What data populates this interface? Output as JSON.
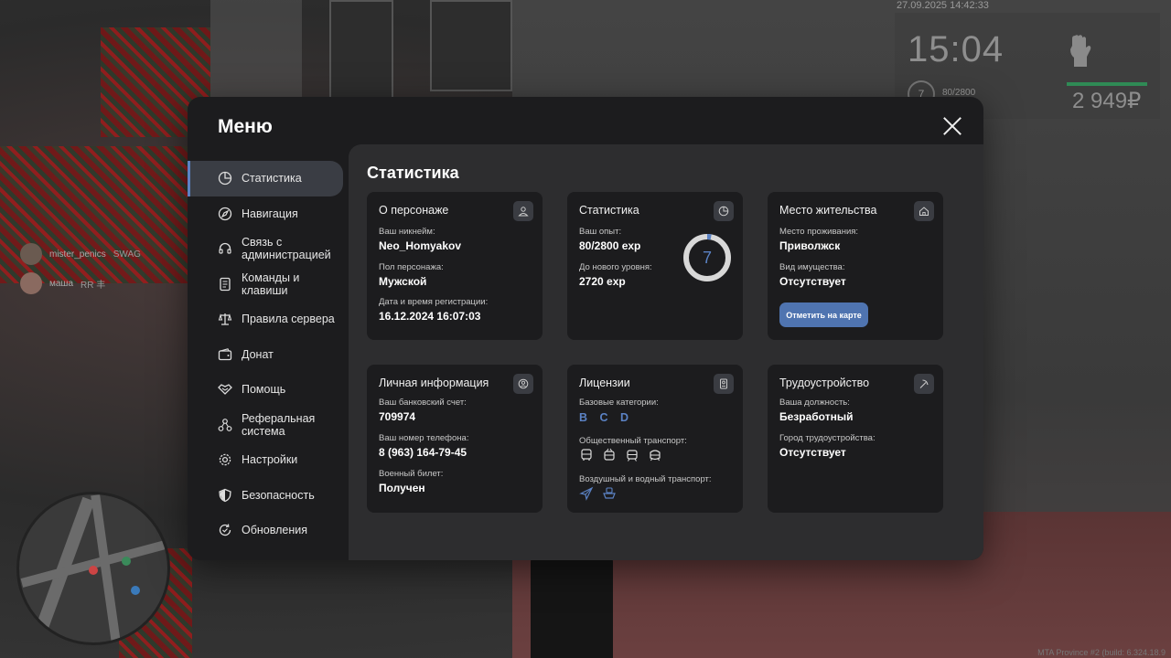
{
  "hud": {
    "datetime": "27.09.2025 14:42:33",
    "time": "15:04",
    "level": "7",
    "exp": "80/2800",
    "money": "2 949₽"
  },
  "chat": [
    {
      "name": "mister_penics",
      "tag": "SWAG"
    },
    {
      "name": "маша",
      "tag": "RR 丰"
    }
  ],
  "footer": "MTA Province #2 (build: 6.324.18.9",
  "menu": {
    "title": "Меню",
    "nav": [
      {
        "label": "Статистика",
        "icon": "stats-pie-icon"
      },
      {
        "label": "Навигация",
        "icon": "compass-icon"
      },
      {
        "label": "Связь с администрацией",
        "icon": "headset-icon"
      },
      {
        "label": "Команды и клавиши",
        "icon": "document-icon"
      },
      {
        "label": "Правила сервера",
        "icon": "scales-icon"
      },
      {
        "label": "Донат",
        "icon": "wallet-icon"
      },
      {
        "label": "Помощь",
        "icon": "handshake-icon"
      },
      {
        "label": "Реферальная система",
        "icon": "network-icon"
      },
      {
        "label": "Настройки",
        "icon": "gear-icon"
      },
      {
        "label": "Безопасность",
        "icon": "shield-icon"
      },
      {
        "label": "Обновления",
        "icon": "update-icon"
      }
    ]
  },
  "content": {
    "title": "Статистика",
    "character": {
      "title": "О персонаже",
      "nickname_label": "Ваш никнейм:",
      "nickname": "Neo_Homyakov",
      "gender_label": "Пол персонажа:",
      "gender": "Мужской",
      "reg_label": "Дата и время регистрации:",
      "reg": "16.12.2024 16:07:03"
    },
    "stats": {
      "title": "Статистика",
      "exp_label": "Ваш опыт:",
      "exp": "80/2800 exp",
      "next_label": "До нового уровня:",
      "next": "2720 exp",
      "level": "7",
      "level_progress": 0.029
    },
    "residence": {
      "title": "Место жительства",
      "place_label": "Место проживания:",
      "place": "Приволжск",
      "property_label": "Вид имущества:",
      "property": "Отсутствует",
      "map_button": "Отметить на карте"
    },
    "personal": {
      "title": "Личная информация",
      "bank_label": "Ваш банковский счет:",
      "bank": "709974",
      "phone_label": "Ваш номер телефона:",
      "phone": "8 (963) 164-79-45",
      "military_label": "Военный билет:",
      "military": "Получен"
    },
    "licenses": {
      "title": "Лицензии",
      "base_label": "Базовые категории:",
      "categories": [
        "B",
        "C",
        "D"
      ],
      "public_label": "Общественный транспорт:",
      "public_icons": [
        "bus-icon",
        "trolleybus-icon",
        "tram-icon",
        "metro-icon"
      ],
      "air_label": "Воздушный и водный транспорт:",
      "air_icons": [
        "plane-icon",
        "boat-icon"
      ]
    },
    "employment": {
      "title": "Трудоустройство",
      "position_label": "Ваша должность:",
      "position": "Безработный",
      "city_label": "Город трудоустройства:",
      "city": "Отсутствует"
    }
  },
  "colors": {
    "accent": "#5b82c4",
    "button": "#4f74b0",
    "card_bg": "#1c1c1e",
    "panel_bg": "#2d2d2f"
  }
}
